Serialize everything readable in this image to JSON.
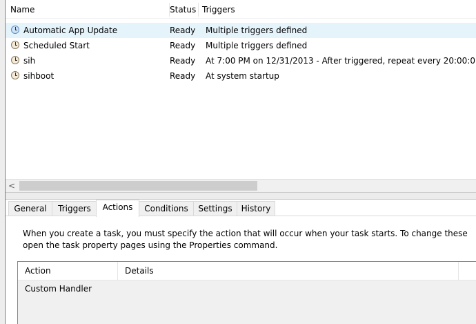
{
  "task_list": {
    "columns": {
      "name": "Name",
      "status": "Status",
      "triggers": "Triggers"
    },
    "rows": [
      {
        "name": "Automatic App Update",
        "status": "Ready",
        "triggers": "Multiple triggers defined",
        "icon": "task-clock-icon-blue",
        "selected": true
      },
      {
        "name": "Scheduled Start",
        "status": "Ready",
        "triggers": "Multiple triggers defined",
        "icon": "task-clock-icon"
      },
      {
        "name": "sih",
        "status": "Ready",
        "triggers": "At 7:00 PM on 12/31/2013 - After triggered, repeat every 20:00:0",
        "icon": "task-clock-icon"
      },
      {
        "name": "sihboot",
        "status": "Ready",
        "triggers": "At system startup",
        "icon": "task-clock-icon"
      }
    ],
    "scroll_left_arrow": "<"
  },
  "tabs": [
    {
      "label": "General"
    },
    {
      "label": "Triggers"
    },
    {
      "label": "Actions",
      "active": true
    },
    {
      "label": "Conditions"
    },
    {
      "label": "Settings"
    },
    {
      "label": "History"
    }
  ],
  "actions_tab": {
    "description_line1": "When you create a task, you must specify the action that will occur when your task starts.  To change these",
    "description_line2": "open the task property pages using the Properties command.",
    "columns": {
      "action": "Action",
      "details": "Details"
    },
    "rows": [
      {
        "action": "Custom Handler",
        "details": ""
      }
    ]
  },
  "colors": {
    "selection": "#e5f3fb",
    "background": "#ffffff",
    "panel": "#f0f0f0"
  }
}
